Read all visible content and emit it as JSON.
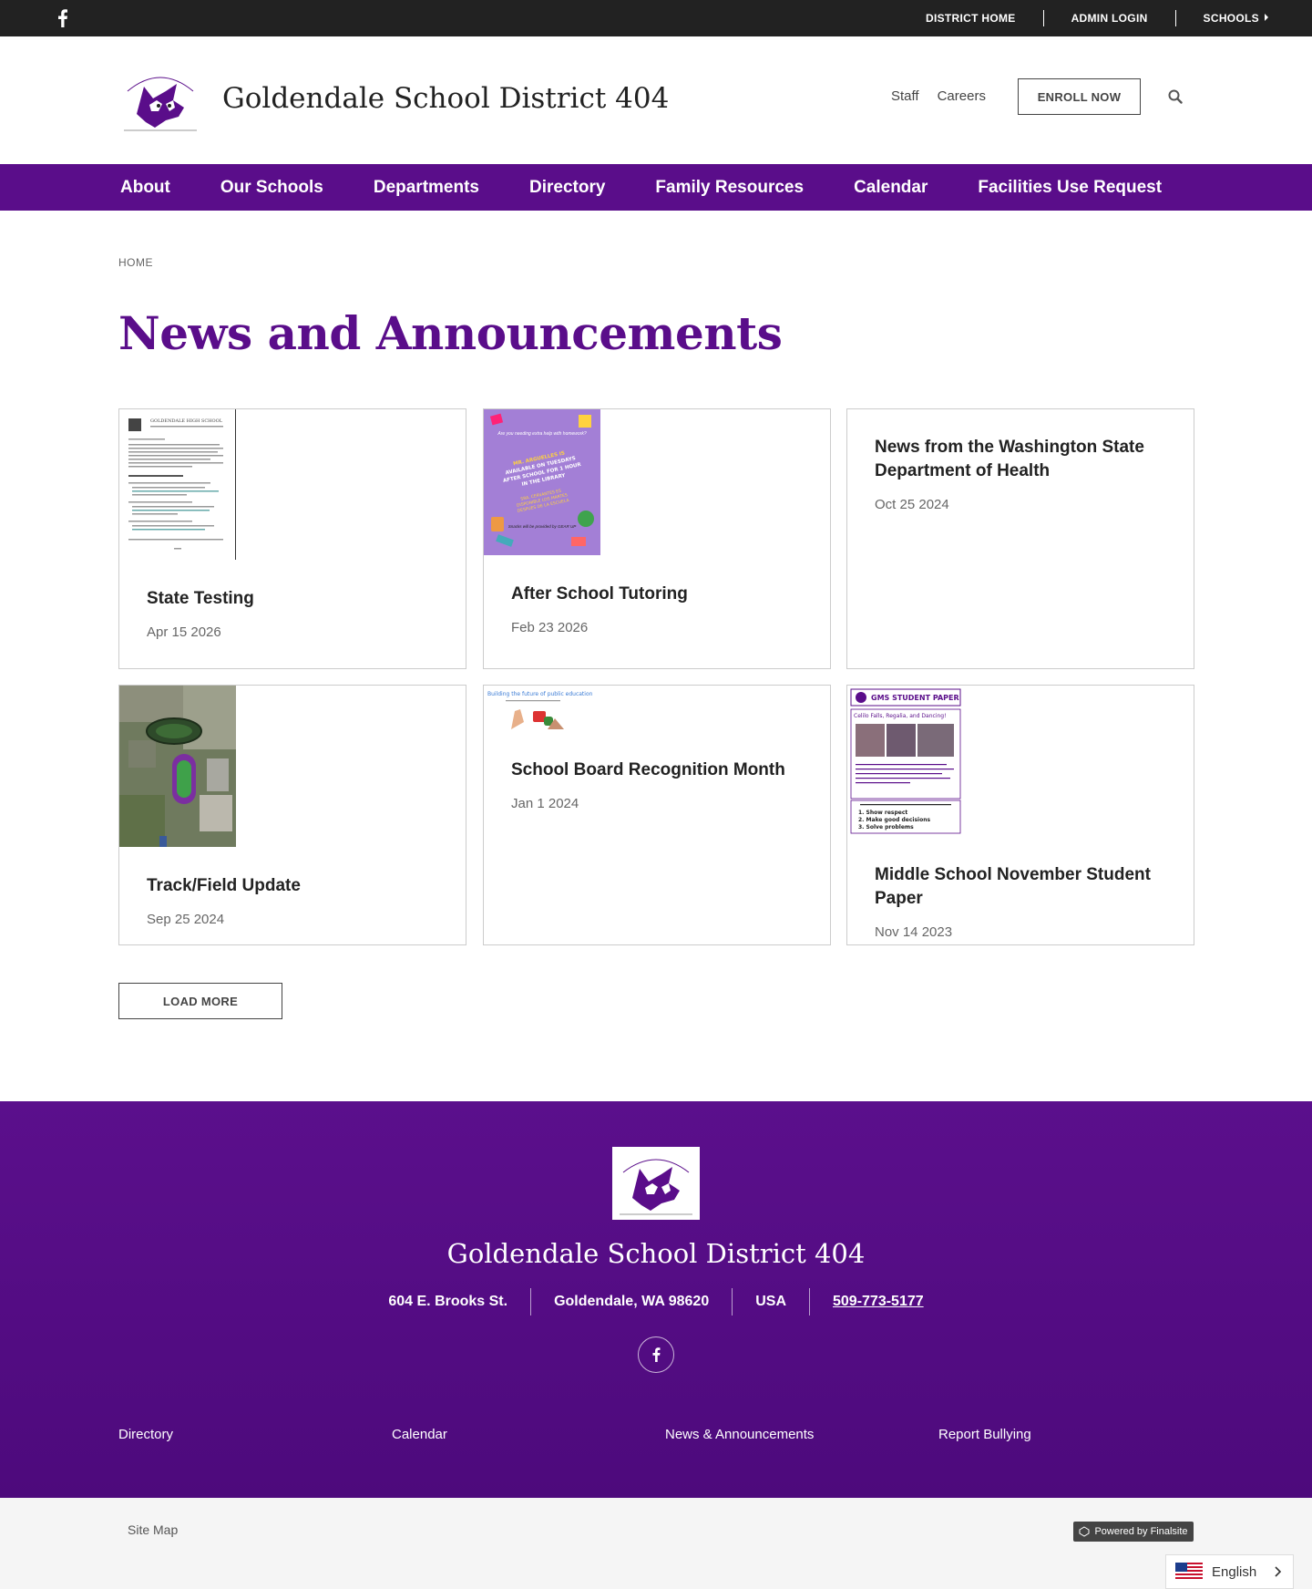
{
  "topbar": {
    "facebook_icon": "facebook-icon",
    "links": [
      {
        "label": "DISTRICT HOME"
      },
      {
        "label": "ADMIN LOGIN"
      },
      {
        "label": "SCHOOLS"
      }
    ]
  },
  "header": {
    "site_title": "Goldendale School District 404",
    "links": [
      {
        "label": "Staff"
      },
      {
        "label": "Careers"
      }
    ],
    "enroll_label": "ENROLL NOW",
    "search_icon": "search-icon",
    "logo_icon": "district-logo-icon"
  },
  "nav": {
    "items": [
      {
        "label": "About"
      },
      {
        "label": "Our Schools"
      },
      {
        "label": "Departments"
      },
      {
        "label": "Directory"
      },
      {
        "label": "Family Resources"
      },
      {
        "label": "Calendar"
      },
      {
        "label": "Facilities Use Request"
      }
    ]
  },
  "breadcrumb": "HOME",
  "page_title": "News and Announcements",
  "news": [
    {
      "title": "State Testing",
      "date": "Apr 15 2026"
    },
    {
      "title": "After School Tutoring",
      "date": "Feb 23 2026"
    },
    {
      "title": "News from the Washington State Department of Health",
      "date": "Oct 25 2024"
    },
    {
      "title": "Track/Field Update",
      "date": "Sep 25 2024"
    },
    {
      "title": "School Board Recognition Month",
      "date": "Jan 1 2024"
    },
    {
      "title": "Middle School November Student Paper",
      "date": "Nov 14 2023"
    }
  ],
  "thumb_text": {
    "flyer_line1": "Are you needing extra help with homework?",
    "flyer_line2": "MR. ARGUELLES IS AVAILABLE ON TUESDAYS AFTER SCHOOL FOR 1 HOUR IN THE LIBRARY",
    "flyer_line3": "Snacks will be provided by GEAR UP",
    "board_banner": "Building the future of public education",
    "paper_header": "GMS STUDENT PAPER",
    "paper_sub": "Celilo Falls, Regalia, and Dancing!",
    "paper_list": [
      "1. Show respect",
      "2. Make good decisions",
      "3. Solve problems"
    ],
    "doc_header": "GOLDENDALE HIGH SCHOOL"
  },
  "load_more_label": "LOAD MORE",
  "footer": {
    "title": "Goldendale School District 404",
    "address": [
      "604 E. Brooks St.",
      "Goldendale, WA  98620",
      "USA",
      "509-773-5177"
    ],
    "facebook_icon": "facebook-icon",
    "links": [
      {
        "label": "Directory"
      },
      {
        "label": "Calendar"
      },
      {
        "label": "News & Announcements"
      },
      {
        "label": "Report Bullying"
      }
    ]
  },
  "bottom": {
    "site_map": "Site Map",
    "powered": "Powered by Finalsite",
    "language": "English",
    "flag_icon": "us-flag-icon"
  },
  "colors": {
    "brand_purple": "#5a0d8a",
    "topbar": "#222222"
  }
}
